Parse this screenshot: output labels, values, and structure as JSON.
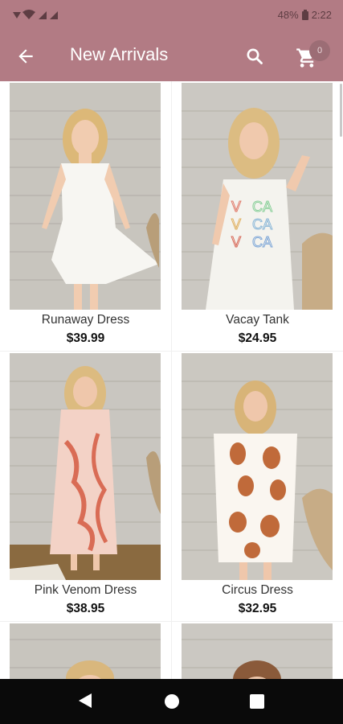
{
  "status": {
    "battery": "48%",
    "time": "2:22"
  },
  "appbar": {
    "title": "New Arrivals",
    "cart_count": "0"
  },
  "products": [
    {
      "name": "Runaway Dress",
      "price": "$39.99",
      "garment": "#f7f6f2",
      "accent": "#f7f6f2"
    },
    {
      "name": "Vacay Tank",
      "price": "$24.95",
      "garment": "#f4f3ee",
      "accent": "#8ab7d8"
    },
    {
      "name": "Pink Venom Dress",
      "price": "$38.95",
      "garment": "#f3d2c6",
      "accent": "#d96c55"
    },
    {
      "name": "Circus Dress",
      "price": "$32.95",
      "garment": "#faf6f0",
      "accent": "#c06a3a"
    }
  ],
  "colors": {
    "accent": "#b27b84",
    "navbar": "#0a0a0a"
  },
  "icons": [
    "back-arrow-icon",
    "search-icon",
    "cart-icon",
    "nav-back-icon",
    "nav-home-icon",
    "nav-recents-icon"
  ]
}
